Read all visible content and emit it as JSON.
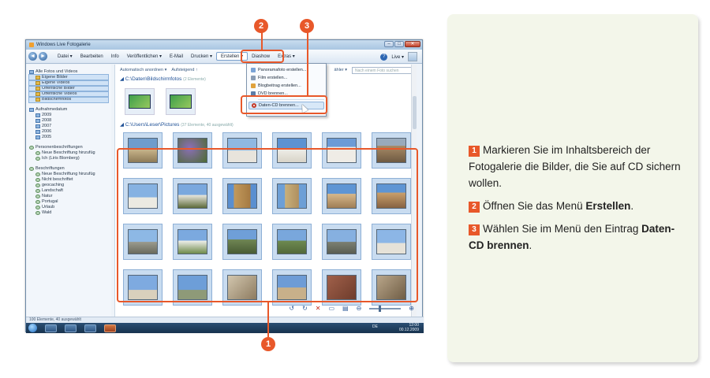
{
  "window": {
    "title": "Windows Live Fotogalerie",
    "controls": [
      "–",
      "□",
      "✕"
    ]
  },
  "menubar": {
    "nav_back": "◄",
    "nav_fwd": "►",
    "items": [
      "Datei ▾",
      "Bearbeiten",
      "Info",
      "Veröffentlichen ▾",
      "E-Mail",
      "Drucken ▾",
      "Erstellen ▾",
      "Diashow",
      "Extras ▾"
    ],
    "help": "?",
    "live": "Live ▾"
  },
  "sidebar": {
    "all": "Alle Fotos und Videos",
    "folders": [
      "Eigene Bilder",
      "Eigene Videos",
      "Öffentliche Bilder",
      "Öffentliche Videos",
      "Bildschirmfotos"
    ],
    "date_head": "Aufnahmedatum",
    "years": [
      "2009",
      "2008",
      "2007",
      "2006",
      "2005"
    ],
    "people_head": "Personenbeschriftungen",
    "people": [
      "Neue Beschriftung hinzufüg",
      "Ich (Liris Blomberg)"
    ],
    "tags_head": "Beschriftungen",
    "tags": [
      "Neue Beschriftung hinzufüg",
      "Nicht beschriftet",
      "geocaching",
      "Landschaft",
      "Natur",
      "Portugal",
      "Urlaub",
      "Wald"
    ]
  },
  "content": {
    "sort1": "Automatisch anordnen ▾",
    "sort2": "Aufsteigend ↑",
    "sort3": "ähler ▾",
    "search_placeholder": "Nach einem Foto suchen",
    "section1_title": "◢ C:\\Daten\\Bildschirmfotos",
    "section1_count": "(2 Elemente)",
    "section2_title": "◢ C:\\Users\\Leser\\Pictures",
    "section2_count": "(37 Elemente, 40 ausgewählt)"
  },
  "dropdown": {
    "items": [
      "Panoramafoto erstellen...",
      "Film erstellen...",
      "Blogbeitrag erstellen...",
      "DVD brennen...",
      "Daten-CD brennen..."
    ]
  },
  "status": {
    "text": "100 Elemente, 40 ausgewählt",
    "tools": [
      "↺",
      "↻",
      "✕",
      "▭",
      "▤",
      "⊖",
      "⊕"
    ]
  },
  "taskbar": {
    "lang": "DE",
    "time": "12:00",
    "date": "00.12.2009"
  },
  "callouts": [
    "1",
    "2",
    "3"
  ],
  "steps": {
    "s1_num": "1",
    "s1_text": "Markieren Sie im Inhaltsbereich der Fotogalerie die Bilder, die Sie auf CD sichern wollen.",
    "s2_num": "2",
    "s2_pre": "Öffnen Sie das Menü ",
    "s2_bold": "Erstellen",
    "s2_post": ".",
    "s3_num": "3",
    "s3_pre": "Wählen Sie im Menü den Eintrag ",
    "s3_bold": "Daten-CD brennen",
    "s3_post": "."
  },
  "colors": {
    "accent": "#e8582a",
    "panel": "#f3f6ea"
  }
}
